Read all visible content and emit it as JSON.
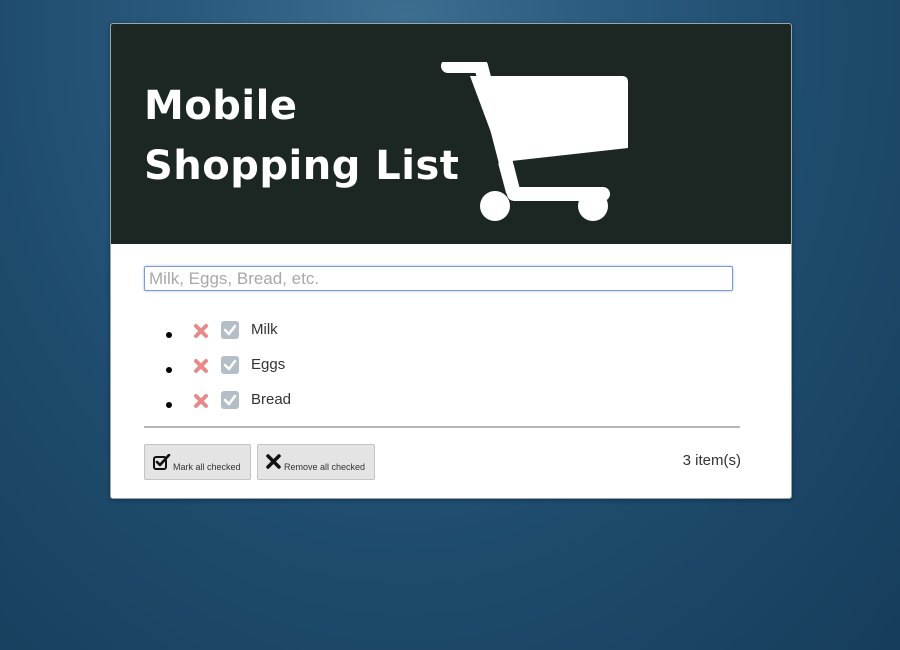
{
  "app": {
    "title_line1": "Mobile",
    "title_line2": "Shopping List"
  },
  "header": {
    "icon": "shopping-cart-icon",
    "background_color": "#1c2724"
  },
  "input": {
    "placeholder": "Milk, Eggs, Bread, etc.",
    "value": ""
  },
  "items": [
    {
      "label": "Milk",
      "checked": false
    },
    {
      "label": "Eggs",
      "checked": false
    },
    {
      "label": "Bread",
      "checked": false
    }
  ],
  "icons": {
    "remove": "remove-x-icon",
    "check": "checkbox-icon",
    "remove_color": "#e88a8a",
    "check_color": "#b3bec6"
  },
  "actions": {
    "mark_all_label": "Mark all checked",
    "mark_all_icon": "check-square-icon",
    "remove_all_label": "Remove all checked",
    "remove_all_icon": "x-icon"
  },
  "footer": {
    "count_text": "3 item(s)"
  }
}
